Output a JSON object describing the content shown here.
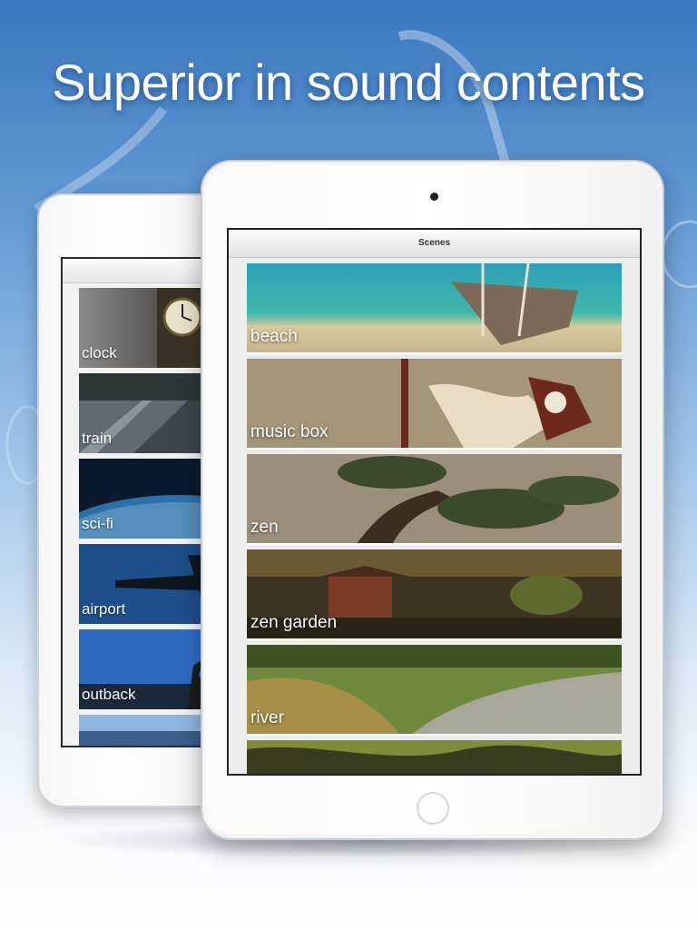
{
  "headline": "Superior in sound contents",
  "back_ipad": {
    "items": [
      {
        "label": "clock"
      },
      {
        "label": "train"
      },
      {
        "label": "sci-fi"
      },
      {
        "label": "airport"
      },
      {
        "label": "outback"
      }
    ]
  },
  "front_ipad": {
    "nav_title": "Scenes",
    "scenes": [
      {
        "label": "beach"
      },
      {
        "label": "music box"
      },
      {
        "label": "zen"
      },
      {
        "label": "zen garden"
      },
      {
        "label": "river"
      }
    ]
  },
  "colors": {
    "bg_top": "#3c78c0",
    "bg_bottom": "#ffffff",
    "headline": "#ffffff"
  }
}
